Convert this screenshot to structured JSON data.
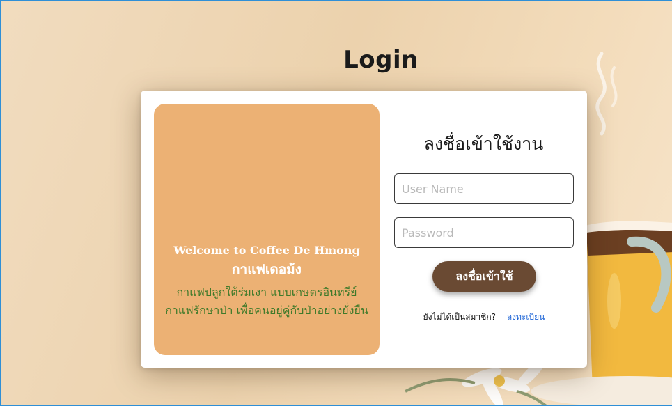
{
  "page": {
    "title": "Login"
  },
  "welcome": {
    "title_en": "Welcome to Coffee De Hmong",
    "title_th": "กาแฟเดอม้ง",
    "tagline_line1": "กาแฟปลูกใต้ร่มเงา แบบเกษตรอินทรีย์",
    "tagline_line2": "กาแฟรักษาป่า เพื่อคนอยู่คู่กับป่าอย่างยั่งยืน"
  },
  "form": {
    "heading": "ลงชื่อเข้าใช้งาน",
    "username_placeholder": "User Name",
    "username_value": "",
    "password_placeholder": "Password",
    "password_value": "",
    "submit_label": "ลงชื่อเข้าใช้",
    "register_prompt": "ยังไม่ได้เป็นสมาชิก?",
    "register_link": "ลงทะเบียน"
  },
  "theme": {
    "panel_color": "#ecb174",
    "button_color": "#6a4a33",
    "tagline_color": "#3f7a2a",
    "link_color": "#1a62d6"
  },
  "icons": {
    "background": "coffee-cup-illustration"
  }
}
